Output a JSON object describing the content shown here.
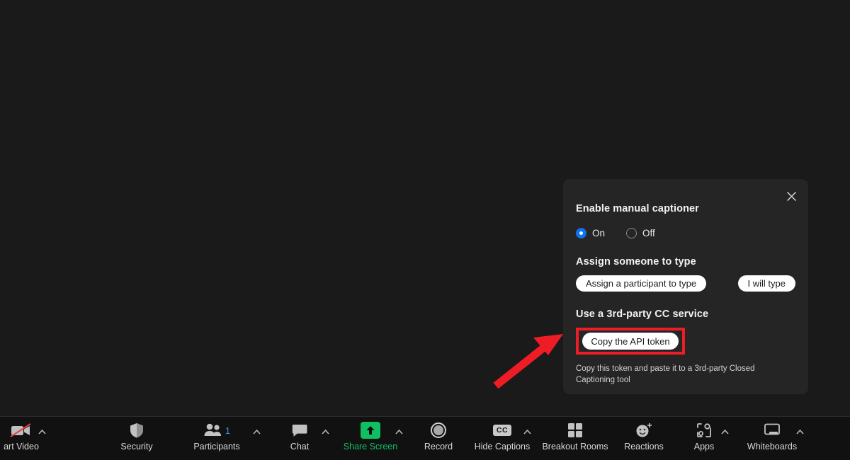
{
  "panel": {
    "close_icon": "close-icon",
    "enable_title": "Enable manual captioner",
    "radio_on_label": "On",
    "radio_off_label": "Off",
    "radio_selected": "On",
    "assign_title": "Assign someone to type",
    "assign_participant_button": "Assign a participant to type",
    "i_will_type_button": "I will type",
    "third_party_title": "Use a 3rd-party CC service",
    "copy_token_button": "Copy the API token",
    "helper_text": "Copy this token and paste it to a 3rd-party Closed Captioning tool",
    "accent_color": "#0e72ed",
    "highlight_color": "#ee1c25",
    "panel_bg": "#252526"
  },
  "toolbar": {
    "items": [
      {
        "label": "art Video",
        "icon": "video-off-icon",
        "has_caret": true,
        "badge": ""
      },
      {
        "label": "Security",
        "icon": "shield-icon",
        "has_caret": false,
        "badge": ""
      },
      {
        "label": "Participants",
        "icon": "participants-icon",
        "has_caret": true,
        "badge": "1"
      },
      {
        "label": "Chat",
        "icon": "chat-bubble-icon",
        "has_caret": true,
        "badge": ""
      },
      {
        "label": "Share Screen",
        "icon": "share-screen-icon",
        "has_caret": true,
        "badge": ""
      },
      {
        "label": "Record",
        "icon": "record-icon",
        "has_caret": false,
        "badge": ""
      },
      {
        "label": "Hide Captions",
        "icon": "cc-icon",
        "has_caret": true,
        "badge": ""
      },
      {
        "label": "Breakout Rooms",
        "icon": "breakout-rooms-icon",
        "has_caret": false,
        "badge": ""
      },
      {
        "label": "Reactions",
        "icon": "reactions-icon",
        "has_caret": false,
        "badge": ""
      },
      {
        "label": "Apps",
        "icon": "apps-icon",
        "has_caret": true,
        "badge": ""
      },
      {
        "label": "Whiteboards",
        "icon": "whiteboard-icon",
        "has_caret": true,
        "badge": ""
      }
    ],
    "cc_text": "CC",
    "share_label_color": "#0fbf62",
    "badge_color": "#3b8ce8"
  },
  "annotation": {
    "arrow_icon": "red-arrow-icon",
    "color": "#ee1c25"
  }
}
